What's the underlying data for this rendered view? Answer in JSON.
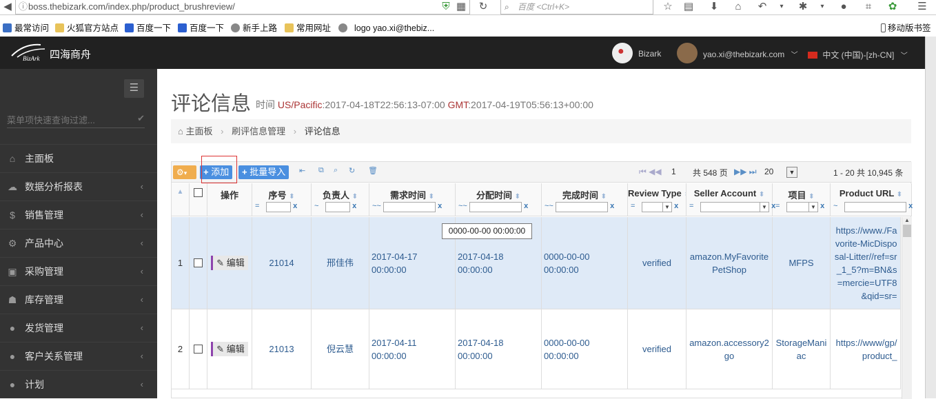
{
  "browser": {
    "url": "boss.thebizark.com/index.php/product_brushreview/",
    "search_placeholder": "百度 <Ctrl+K>",
    "bookmarks": [
      "最常访问",
      "火狐官方站点",
      "百度一下",
      "百度一下",
      "新手上路",
      "常用网址",
      "logo yao.xi@thebiz..."
    ],
    "mobile_bookmarks": "移动版书签"
  },
  "header": {
    "brand": "四海商舟",
    "logo_text": "BizArk",
    "company": "Bizark",
    "user_email": "yao.xi@thebizark.com",
    "language": "中文 (中国)-[zh-CN]"
  },
  "sidebar": {
    "filter_placeholder": "菜单项快速查询过滤...",
    "items": [
      {
        "label": "主面板",
        "icon": "home-icon",
        "glyph": "⌂"
      },
      {
        "label": "数据分析报表",
        "icon": "cloud-icon",
        "glyph": "☁"
      },
      {
        "label": "销售管理",
        "icon": "dollar-icon",
        "glyph": "$"
      },
      {
        "label": "产品中心",
        "icon": "cogs-icon",
        "glyph": "⚙"
      },
      {
        "label": "采购管理",
        "icon": "cube-icon",
        "glyph": "▣"
      },
      {
        "label": "库存管理",
        "icon": "android-icon",
        "glyph": "☗"
      },
      {
        "label": "发货管理",
        "icon": "circle-icon",
        "glyph": "●"
      },
      {
        "label": "客户关系管理",
        "icon": "circle-icon",
        "glyph": "●"
      },
      {
        "label": "计划",
        "icon": "circle-icon",
        "glyph": "●"
      }
    ]
  },
  "page": {
    "title": "评论信息",
    "time_label": "时间",
    "tz_label": "US/Pacific",
    "tz_time": ":2017-04-18T22:56:13-07:00",
    "gmt_label": "GMT",
    "gmt_time": ":2017-04-19T05:56:13+00:00",
    "breadcrumb": [
      "主面板",
      "刷评信息管理",
      "评论信息"
    ]
  },
  "toolbar": {
    "add_label": "添加",
    "import_label": "批量导入",
    "page_current": "1",
    "page_total": "共 548 页",
    "page_size": "20",
    "records": "1 - 20  共 10,945 条"
  },
  "columns": [
    {
      "label": "",
      "filter": ""
    },
    {
      "label": "",
      "filter": ""
    },
    {
      "label": "操作",
      "filter": ""
    },
    {
      "label": "序号",
      "filter": "="
    },
    {
      "label": "负责人",
      "filter": "~"
    },
    {
      "label": "需求时间",
      "filter": "~~"
    },
    {
      "label": "分配时间",
      "filter": "~~"
    },
    {
      "label": "完成时间",
      "filter": "~~"
    },
    {
      "label": "Review Type",
      "filter": "="
    },
    {
      "label": "Seller Account",
      "filter": "="
    },
    {
      "label": "项目",
      "filter": "="
    },
    {
      "label": "Product URL",
      "filter": "~"
    }
  ],
  "rows": [
    {
      "num": "1",
      "edit": "编辑",
      "id": "21014",
      "owner": "邢佳伟",
      "req_time": "2017-04-17 00:00:00",
      "assign_time": "2017-04-18 00:00:00",
      "done_time": "0000-00-00 00:00:00",
      "review": "verified",
      "account": "amazon.MyFavoritePetShop",
      "project": "MFPS",
      "url": "https://www./Favorite-MicDisposal-Litter//ref=sr_1_5?m=BN&s=mercie=UTF8&qid=sr="
    },
    {
      "num": "2",
      "edit": "编辑",
      "id": "21013",
      "owner": "倪云慧",
      "req_time": "2017-04-11 00:00:00",
      "assign_time": "2017-04-18 00:00:00",
      "done_time": "0000-00-00 00:00:00",
      "review": "verified",
      "account": "amazon.accessory2go",
      "project": "StorageManiac",
      "url": "https://www/gp/product_"
    }
  ],
  "tooltip": "0000-00-00 00:00:00"
}
